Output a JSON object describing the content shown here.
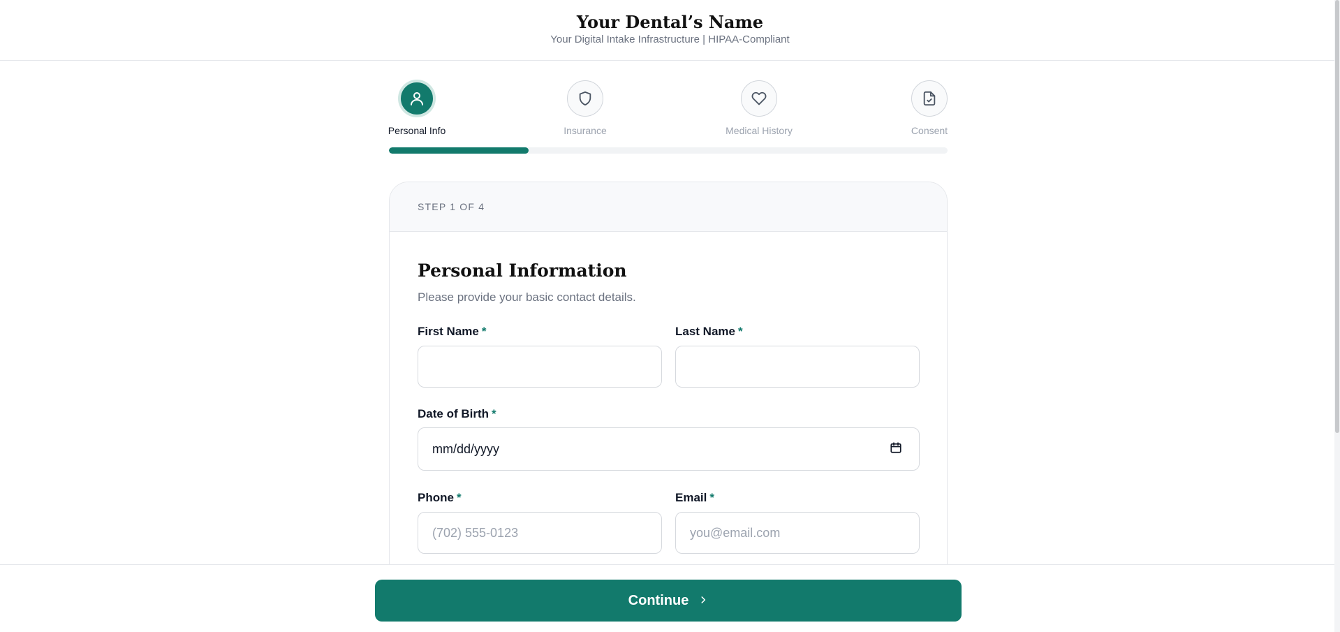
{
  "header": {
    "title": "Your Dental’s Name",
    "subtitle": "Your Digital Intake Infrastructure | HIPAA-Compliant"
  },
  "steps": [
    {
      "label": "Personal Info",
      "icon": "user-icon",
      "active": true
    },
    {
      "label": "Insurance",
      "icon": "shield-icon",
      "active": false
    },
    {
      "label": "Medical History",
      "icon": "heart-icon",
      "active": false
    },
    {
      "label": "Consent",
      "icon": "file-check-icon",
      "active": false
    }
  ],
  "progress": {
    "fraction": 0.25
  },
  "card": {
    "step_indicator": "STEP 1 OF 4",
    "title": "Personal Information",
    "subtitle": "Please provide your basic contact details."
  },
  "form": {
    "first_name": {
      "label": "First Name",
      "required_mark": "*",
      "value": "",
      "placeholder": ""
    },
    "last_name": {
      "label": "Last Name",
      "required_mark": "*",
      "value": "",
      "placeholder": ""
    },
    "dob": {
      "label": "Date of Birth",
      "required_mark": "*",
      "placeholder": "mm/dd/yyyy"
    },
    "phone": {
      "label": "Phone",
      "required_mark": "*",
      "placeholder": "(702) 555-0123"
    },
    "email": {
      "label": "Email",
      "required_mark": "*",
      "placeholder": "you@email.com"
    }
  },
  "footer": {
    "continue_label": "Continue"
  },
  "colors": {
    "accent": "#127a6c",
    "muted_text": "#6b7280",
    "border": "#e5e7eb"
  }
}
